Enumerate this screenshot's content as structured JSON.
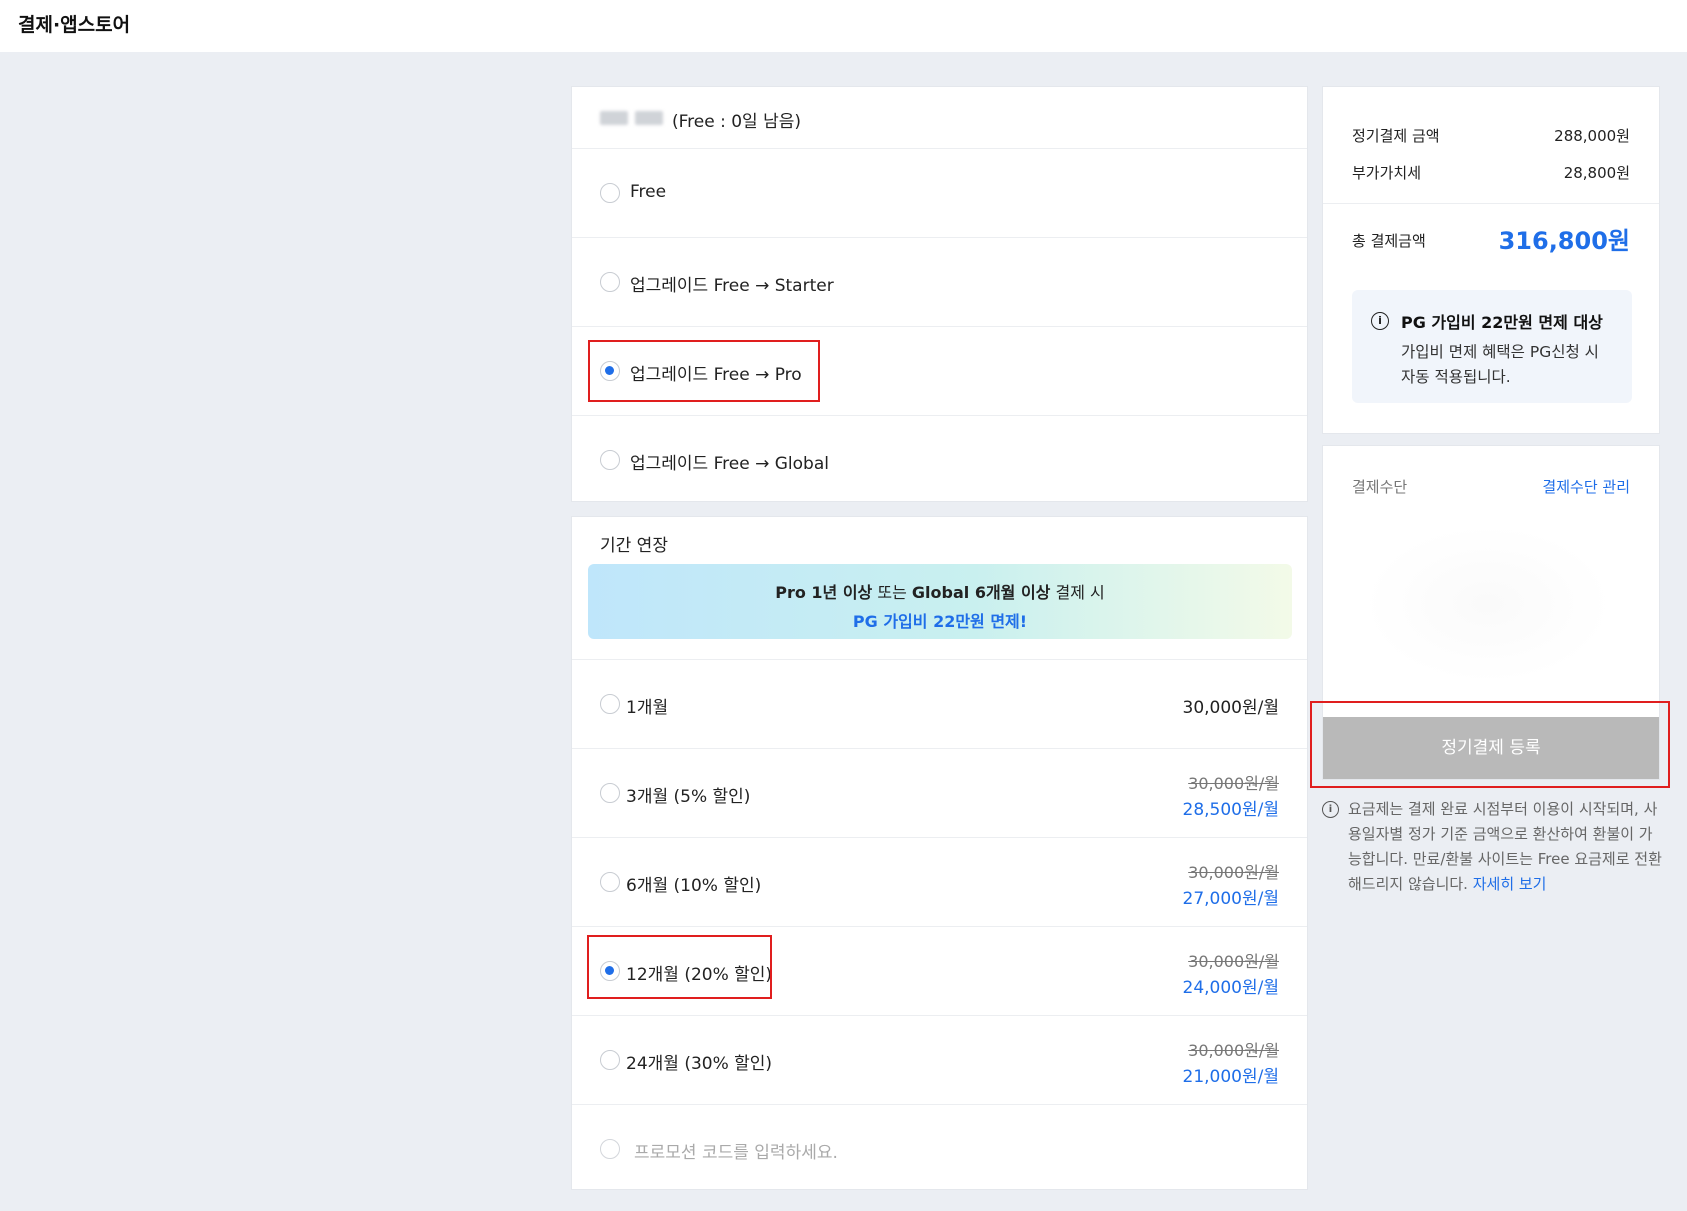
{
  "header": {
    "title": "결제·앱스토어"
  },
  "plan": {
    "status": "(Free : 0일 남음)",
    "options": [
      {
        "label": "Free",
        "selected": false
      },
      {
        "label": "업그레이드 Free → Starter",
        "selected": false
      },
      {
        "label": "업그레이드 Free → Pro",
        "selected": true
      },
      {
        "label": "업그레이드 Free → Global",
        "selected": false
      }
    ]
  },
  "period": {
    "title": "기간 연장",
    "banner": {
      "bold1": "Pro 1년 이상",
      "mid": " 또는 ",
      "bold2": "Global 6개월 이상",
      "tail": " 결제 시",
      "highlight": "PG 가입비 22만원 면제!"
    },
    "options": [
      {
        "label": "1개월",
        "price": "30,000원/월",
        "selected": false
      },
      {
        "label": "3개월 (5% 할인)",
        "original": "30,000원/월",
        "discounted": "28,500원/월",
        "selected": false
      },
      {
        "label": "6개월 (10% 할인)",
        "original": "30,000원/월",
        "discounted": "27,000원/월",
        "selected": false
      },
      {
        "label": "12개월 (20% 할인)",
        "original": "30,000원/월",
        "discounted": "24,000원/월",
        "selected": true
      },
      {
        "label": "24개월 (30% 할인)",
        "original": "30,000원/월",
        "discounted": "21,000원/월",
        "selected": false
      }
    ],
    "promo_placeholder": "프로모션 코드를 입력하세요."
  },
  "summary": {
    "subscription_label": "정기결제 금액",
    "subscription_value": "288,000원",
    "vat_label": "부가가치세",
    "vat_value": "28,800원",
    "total_label": "총 결제금액",
    "total_value": "316,800원",
    "info_title": "PG 가입비 22만원 면제 대상",
    "info_desc": "가입비 면제 혜택은 PG신청 시 자동 적용됩니다."
  },
  "payment": {
    "label": "결제수단",
    "manage_link": "결제수단 관리",
    "register_button": "정기결제 등록"
  },
  "notice": {
    "text": "요금제는 결제 완료 시점부터 이용이 시작되며, 사용일자별 정가 기준 금액으로 환산하여 환불이 가능합니다. 만료/환불 사이트는 Free 요금제로 전환해드리지 않습니다.",
    "link": "자세히 보기"
  },
  "colors": {
    "accent": "#1f6ee8",
    "highlight_box": "#e01e1e",
    "button_disabled": "#b9b9b9"
  }
}
